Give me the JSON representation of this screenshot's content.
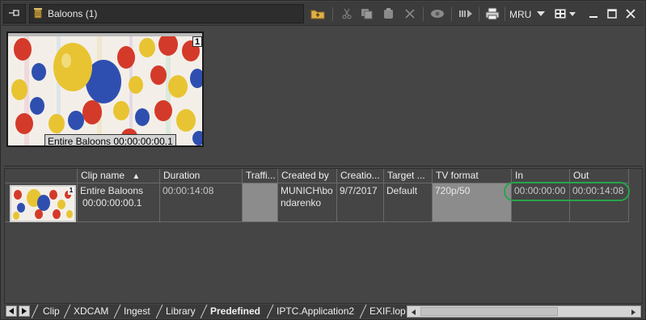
{
  "window": {
    "title": "Baloons (1)",
    "mru_label": "MRU"
  },
  "thumbnail": {
    "badge": "1",
    "caption": "Entire Baloons 00:00:00:00.1"
  },
  "table": {
    "columns": [
      "Clip name",
      "Duration",
      "Traffi...",
      "Created by",
      "Creatio...",
      "Target ...",
      "TV format",
      "In",
      "Out"
    ],
    "sort_indicator": "▲",
    "rows": [
      {
        "badge": "1",
        "clip_name_line1": "Entire Baloons",
        "clip_name_line2": "00:00:00:00.1",
        "duration": "00:00:14:08",
        "traffic": "",
        "created_by_line1": "MUNICH\\bo",
        "created_by_line2": "ndarenko",
        "creation": "9/7/2017",
        "target": "Default",
        "tv_format": "720p/50",
        "in": "00:00:00:00",
        "out": "00:00:14:08"
      }
    ]
  },
  "tabs": [
    {
      "label": "Clip",
      "active": false
    },
    {
      "label": "XDCAM",
      "active": false
    },
    {
      "label": "Ingest",
      "active": false
    },
    {
      "label": "Library",
      "active": false
    },
    {
      "label": "Predefined",
      "active": true
    },
    {
      "label": "IPTC.Application2",
      "active": false
    },
    {
      "label": "EXIF.lop",
      "active": false
    }
  ],
  "colors": {
    "background": "#454545",
    "highlight_ring": "#27a54c",
    "gray_cell": "#8c8c8c"
  },
  "icons": [
    "pin-icon",
    "clip-bin-icon",
    "folder-up-icon",
    "cut-icon",
    "copy-icon",
    "paste-icon",
    "delete-icon",
    "eye-icon",
    "play-list-icon",
    "print-icon",
    "mru-dropdown-icon",
    "view-options-icon",
    "minimize-icon",
    "maximize-icon",
    "close-icon"
  ]
}
